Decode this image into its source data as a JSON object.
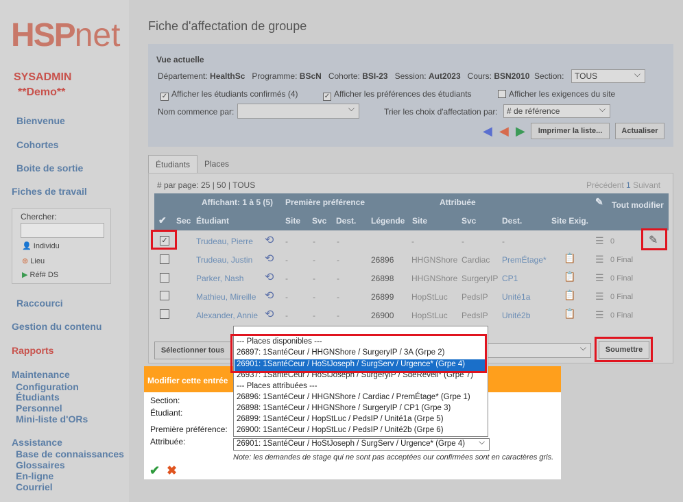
{
  "sidebar": {
    "logo_hsp": "HSP",
    "logo_net": "net",
    "user": "SYSADMIN",
    "demo": "**Demo**",
    "bienvenue": "Bienvenue",
    "cohortes": "Cohortes",
    "boite": "Boite de sortie",
    "fiches": "Fiches de travail",
    "chercher": "Chercher:",
    "individu": "Individu",
    "lieu": "Lieu",
    "refds": "Réf# DS",
    "raccourci": "Raccourci",
    "gestion": "Gestion du contenu",
    "rapports": "Rapports",
    "maintenance": "Maintenance",
    "configuration": "Configuration",
    "etudiants": "Étudiants",
    "personnel": "Personnel",
    "miniliste": "Mini-liste d'ORs",
    "assistance": "Assistance",
    "base": "Base de connaissances",
    "glossaires": "Glossaires",
    "enligne": "En-ligne",
    "courriel": "Courriel"
  },
  "page": {
    "title": "Fiche d'affectation de groupe"
  },
  "view": {
    "heading": "Vue actuelle",
    "dept_label": "Département:",
    "dept": "HealthSc",
    "prog_label": "Programme:",
    "prog": "BScN",
    "cohort_label": "Cohorte:",
    "cohort": "BSI-23",
    "session_label": "Session:",
    "session": "Aut2023",
    "course_label": "Cours:",
    "course": "BSN2010",
    "section_label": "Section:",
    "section_value": "TOUS",
    "chk_confirmed": "Afficher les étudiants confirmés (4)",
    "chk_prefs": "Afficher les préférences des étudiants",
    "chk_reqs": "Afficher les exigences du site",
    "name_label": "Nom commence par:",
    "sort_label": "Trier les choix d'affectation par:",
    "sort_value": "# de référence",
    "print_btn": "Imprimer la liste...",
    "refresh_btn": "Actualiser"
  },
  "tabs": [
    "Étudiants",
    "Places"
  ],
  "grid": {
    "per_page": "# par page: 25 | 50 | TOUS",
    "prev": "Précédent",
    "page": "1",
    "next": "Suivant",
    "showing": "Affichant: 1 à 5 (5)",
    "first_pref": "Première préférence",
    "assigned": "Attribuée",
    "edit_all": "Tout modifier",
    "cols": [
      "Sec",
      "Étudiant",
      "Site",
      "Svc",
      "Dest.",
      "Légende",
      "Site",
      "Svc",
      "Dest.",
      "Site Exig."
    ],
    "rows": [
      {
        "name": "Trudeau, Pierre",
        "p_site": "-",
        "p_svc": "-",
        "p_dest": "-",
        "legend": "",
        "a_site": "-",
        "a_svc": "-",
        "a_dest": "-",
        "count": "0",
        "final": ""
      },
      {
        "name": "Trudeau, Justin",
        "p_site": "-",
        "p_svc": "-",
        "p_dest": "-",
        "legend": "26896",
        "a_site": "HHGNShore",
        "a_svc": "Cardiac",
        "a_dest": "PremÉtage*",
        "count": "0",
        "final": "Final"
      },
      {
        "name": "Parker, Nash",
        "p_site": "-",
        "p_svc": "-",
        "p_dest": "-",
        "legend": "26898",
        "a_site": "HHGNShore",
        "a_svc": "SurgeryIP",
        "a_dest": "CP1",
        "count": "0",
        "final": "Final"
      },
      {
        "name": "Mathieu, Mireille",
        "p_site": "-",
        "p_svc": "-",
        "p_dest": "-",
        "legend": "26899",
        "a_site": "HopStLuc",
        "a_svc": "PedsIP",
        "a_dest": "Unité1a",
        "count": "0",
        "final": "Final"
      },
      {
        "name": "Alexander, Annie",
        "p_site": "-",
        "p_svc": "-",
        "p_dest": "-",
        "legend": "26900",
        "a_site": "HopStLuc",
        "a_svc": "PedsIP",
        "a_dest": "Unité2b",
        "count": "0",
        "final": "Final"
      }
    ],
    "select_all": "Sélectionner tous",
    "submit": "Soumettre"
  },
  "dropdown": {
    "items": [
      "--- Places disponibles ---",
      "26897: 1SantéCeur / HHGNShore / SurgeryIP / 3A (Grpe 2)",
      "26901: 1SantéCeur / HoStJoseph / SurgServ / Urgence* (Grpe 4)",
      "26937: 1SantéCeur / HoStJoseph / SurgeryIP / SdeReveil* (Grpe 7)",
      "--- Places attribuées ---",
      "26896: 1SantéCeur / HHGNShore / Cardiac / PremÉtage* (Grpe 1)",
      "26898: 1SantéCeur / HHGNShore / SurgeryIP / CP1 (Grpe 3)",
      "26899: 1SantéCeur / HopStLuc / PedsIP / Unité1a (Grpe 5)",
      "26900: 1SantéCeur / HopStLuc / PedsIP / Unité2b (Grpe 6)"
    ],
    "selected_index": 2
  },
  "modal": {
    "title": "Modifier cette entrée",
    "section": "Section:",
    "student": "Étudiant:",
    "first_pref": "Première préférence:",
    "assigned": "Attribuée:",
    "assigned_value": "26901: 1SantéCeur / HoStJoseph / SurgServ / Urgence* (Grpe 4)",
    "note": "Note: les demandes de stage qui ne sont pas acceptées our confirmées sont en caractères gris."
  },
  "colors": {
    "accent_orange": "#ff9f1c",
    "highlight_red": "#e0141f",
    "selection_blue": "#1a6fc9",
    "header_blue": "#6f8597"
  }
}
